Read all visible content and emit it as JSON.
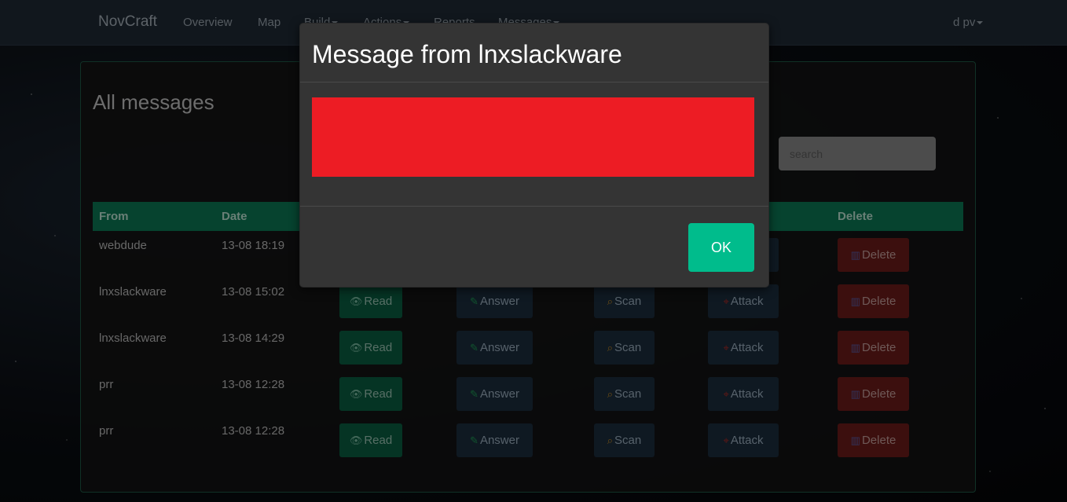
{
  "navbar": {
    "brand": "NovCraft",
    "items": [
      "Overview",
      "Map",
      "Build",
      "Actions",
      "Reports",
      "Messages"
    ],
    "user": "d pv"
  },
  "messages": {
    "title": "All messages",
    "search_placeholder": "search",
    "columns": {
      "from": "From",
      "date": "Date",
      "delete": "Delete"
    },
    "rows": [
      {
        "from": "webdude",
        "date": "13-08 18:19"
      },
      {
        "from": "lnxslackware",
        "date": "13-08 15:02"
      },
      {
        "from": "lnxslackware",
        "date": "13-08 14:29"
      },
      {
        "from": "prr",
        "date": "13-08 12:28"
      },
      {
        "from": "prr",
        "date": "13-08 12:28"
      }
    ],
    "buttons": {
      "read": "Read",
      "answer": "Answer",
      "scan": "Scan",
      "attack": "Attack",
      "delete": "Delete"
    }
  },
  "modal": {
    "title": "Message from lnxslackware",
    "body_color": "#ed1c24",
    "ok_label": "OK"
  },
  "colors": {
    "navbar": "#1f2a36",
    "table_header": "#0b7a56",
    "ok_button": "#00bc8c",
    "read_button": "#0a5f43",
    "delete_button": "#6e1c1a"
  }
}
